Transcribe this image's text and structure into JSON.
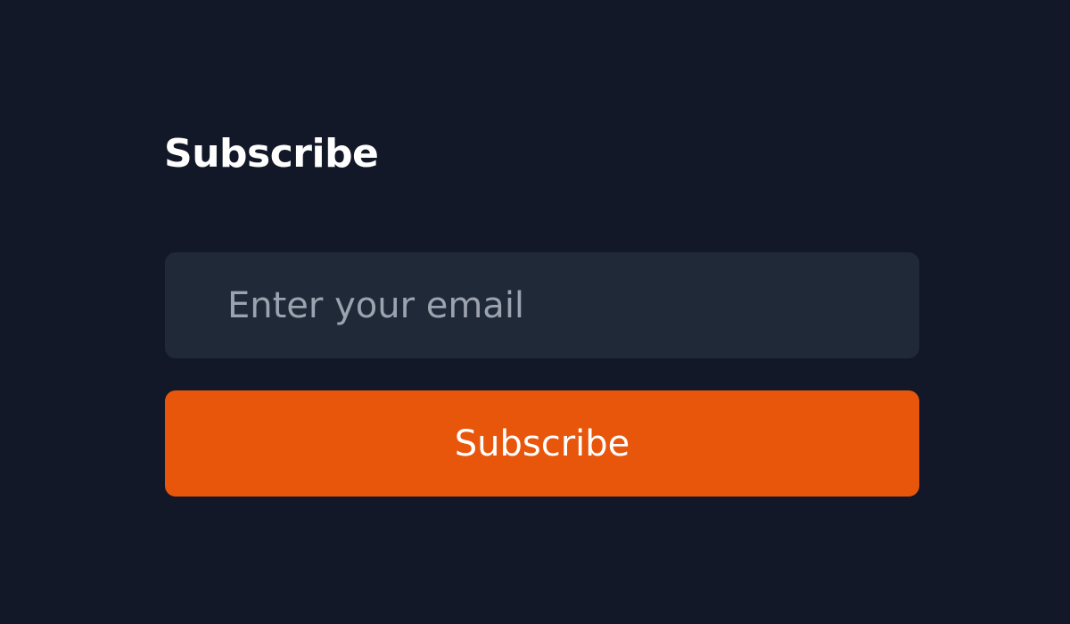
{
  "newsletter": {
    "title": "Subscribe",
    "email_placeholder": "Enter your email",
    "email_value": "",
    "button_label": "Subscribe"
  },
  "colors": {
    "background": "#121827",
    "input_background": "#202938",
    "placeholder": "#9ca3af",
    "accent": "#e8560c",
    "text": "#ffffff"
  }
}
